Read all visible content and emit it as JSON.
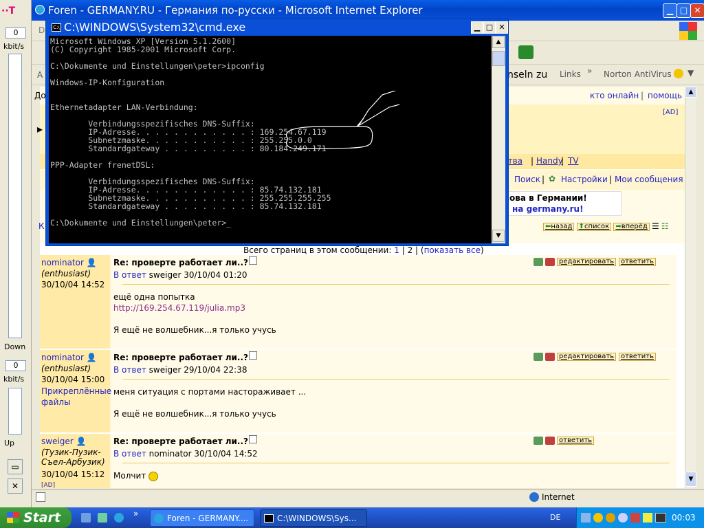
{
  "meter": {
    "logo": "··T",
    "down_value": "0",
    "down_unit": "kbit/s",
    "down_label": "Down",
    "up_value": "0",
    "up_unit": "kbit/s",
    "up_label": "Up"
  },
  "ie": {
    "title": "Foren - GERMANY.RU - Германия по-русски - Microsoft Internet Explorer",
    "menu_partial": "D",
    "addr_label": "A",
    "links_partial": "nseln zu",
    "links_label": "Links",
    "norton": "Norton AntiVirus",
    "row_do": "До",
    "kto_online": "кто онлайн",
    "pomosch": "помощь",
    "ad": "[AD]",
    "nav_links": [
      "ства",
      "Handy",
      "TV"
    ],
    "poisk": "Поиск",
    "nastroiki": "Настройки",
    "moi_soobscheniya": "Мои сообщения",
    "banner_line1": "ова в Германии!",
    "banner_line2": "на germany.ru!",
    "nav_back": "назад",
    "nav_list": "список",
    "nav_fwd": "вперёд",
    "k": "К",
    "pages_label": "Всего страниц в этом сообщении:",
    "page_1": "1",
    "page_2": "2",
    "show_all": "показать все",
    "status_zone": "Internet"
  },
  "posts": [
    {
      "user": "nominator",
      "status": "(enthusiast)",
      "date": "30/10/04 14:52",
      "attach": "",
      "subject": "Re: проверте работает ли..?",
      "reply_to_prefix": "В ответ",
      "reply_to": "sweiger 30/10/04 01:20",
      "text1": "ещё одна попытка",
      "link": "http://169.254.67.119/julia.mp3",
      "sig": "Я ещё не волшебник...я только учусь",
      "edit": "редактировать",
      "reply": "ответить"
    },
    {
      "user": "nominator",
      "status": "(enthusiast)",
      "date": "30/10/04 15:00",
      "attach": "Прикреплённые файлы",
      "subject": "Re: проверте работает ли..?",
      "reply_to_prefix": "В ответ",
      "reply_to": "sweiger 29/10/04 22:38",
      "text1": "меня ситуация с портами настораживает ...",
      "link": "",
      "sig": "Я ещё не волшебник...я только учусь",
      "edit": "редактировать",
      "reply": "ответить"
    },
    {
      "user": "sweiger",
      "status": "(Тузик-Пузик-Съел-Арбузик)",
      "date": "30/10/04 15:12",
      "attach": "[AD]",
      "subject": "Re: проверте работает ли..?",
      "reply_to_prefix": "В ответ",
      "reply_to": "nominator 30/10/04 14:52",
      "text1": "Молчит",
      "link": "",
      "sig": "",
      "edit": "",
      "reply": "ответить"
    }
  ],
  "cmd": {
    "title": "C:\\WINDOWS\\System32\\cmd.exe",
    "lines": [
      "Microsoft Windows XP [Version 5.1.2600]",
      "(C) Copyright 1985-2001 Microsoft Corp.",
      "",
      "C:\\Dokumente und Einstellungen\\peter>ipconfig",
      "",
      "Windows-IP-Konfiguration",
      "",
      "",
      "Ethernetadapter LAN-Verbindung:",
      "",
      "        Verbindungsspezifisches DNS-Suffix:",
      "        IP-Adresse. . . . . . . . . . . . : 169.254.67.119",
      "        Subnetzmaske. . . . . . . . . . . : 255.255.0.0",
      "        Standardgateway . . . . . . . . . : 80.184.249.171",
      "",
      "PPP-Adapter frenetDSL:",
      "",
      "        Verbindungsspezifisches DNS-Suffix:",
      "        IP-Adresse. . . . . . . . . . . . : 85.74.132.181",
      "        Subnetzmaske. . . . . . . . . . . : 255.255.255.255",
      "        Standardgateway . . . . . . . . . : 85.74.132.181",
      "",
      "C:\\Dokumente und Einstellungen\\peter>_"
    ]
  },
  "taskbar": {
    "start": "Start",
    "task1": "Foren - GERMANY....",
    "task2": "C:\\WINDOWS\\Sys...",
    "lang": "DE",
    "clock": "00:03"
  },
  "colors": {
    "xp_blue": "#0a4fd8",
    "start_green": "#3f9f3f",
    "link_blue": "#2226c2",
    "post_side": "#ffeaa8"
  }
}
